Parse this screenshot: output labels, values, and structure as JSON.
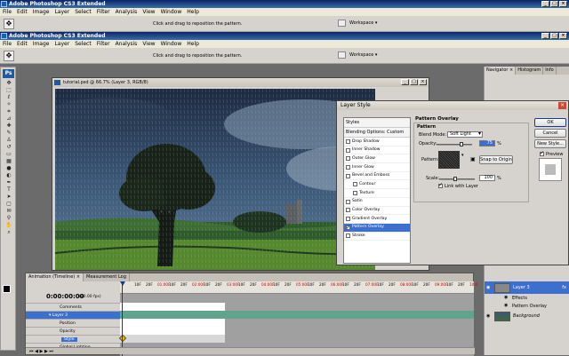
{
  "app": {
    "title": "Adobe Photoshop CS3 Extended",
    "menu": [
      "File",
      "Edit",
      "Image",
      "Layer",
      "Select",
      "Filter",
      "Analysis",
      "View",
      "Window",
      "Help"
    ],
    "options_hint": "Click and drag to reposition the pattern.",
    "workspace_label": "Workspace ▾"
  },
  "document": {
    "title": "tutorial.psd @ 66.7% (Layer 3, RGB/8)"
  },
  "navigator": {
    "tabs": [
      "Navigator ×",
      "Histogram",
      "Info"
    ]
  },
  "layer_style": {
    "title": "Layer Style",
    "list_header": "Styles",
    "blending": "Blending Options: Custom",
    "items": [
      {
        "label": "Drop Shadow",
        "checked": false,
        "sub": false,
        "selected": false
      },
      {
        "label": "Inner Shadow",
        "checked": false,
        "sub": false,
        "selected": false
      },
      {
        "label": "Outer Glow",
        "checked": false,
        "sub": false,
        "selected": false
      },
      {
        "label": "Inner Glow",
        "checked": false,
        "sub": false,
        "selected": false
      },
      {
        "label": "Bevel and Emboss",
        "checked": false,
        "sub": false,
        "selected": false
      },
      {
        "label": "Contour",
        "checked": false,
        "sub": true,
        "selected": false
      },
      {
        "label": "Texture",
        "checked": false,
        "sub": true,
        "selected": false
      },
      {
        "label": "Satin",
        "checked": false,
        "sub": false,
        "selected": false
      },
      {
        "label": "Color Overlay",
        "checked": false,
        "sub": false,
        "selected": false
      },
      {
        "label": "Gradient Overlay",
        "checked": false,
        "sub": false,
        "selected": false
      },
      {
        "label": "Pattern Overlay",
        "checked": true,
        "sub": false,
        "selected": true
      },
      {
        "label": "Stroke",
        "checked": false,
        "sub": false,
        "selected": false
      }
    ],
    "section_title": "Pattern Overlay",
    "group_title": "Pattern",
    "blend_mode_label": "Blend Mode:",
    "blend_mode_value": "Soft Light",
    "opacity_label": "Opacity:",
    "opacity_value": "75",
    "pattern_label": "Pattern:",
    "snap_button": "Snap to Origin",
    "scale_label": "Scale:",
    "scale_value": "100",
    "percent": "%",
    "link_label": "Link with Layer",
    "ok": "OK",
    "cancel": "Cancel",
    "new_style": "New Style...",
    "preview_label": "Preview"
  },
  "layers": {
    "layer3": "Layer 3",
    "effects": "Effects",
    "pattern_overlay": "Pattern Overlay",
    "background": "Background"
  },
  "animation": {
    "tabs": [
      "Animation (Timeline) ×",
      "Measurement Log"
    ],
    "time": "0:00:00:00",
    "fps": "(30.00 fps)",
    "rows": {
      "comments": "Comments",
      "layer": "Layer 3",
      "position": "Position",
      "opacity": "Opacity",
      "style": "Style",
      "global_lighting": "Global Lighting"
    },
    "ticks": [
      "10F",
      "20F",
      "01:00F",
      "10F",
      "20F",
      "02:00F",
      "10F",
      "20F",
      "03:00F",
      "10F",
      "20F",
      "04:00F",
      "10F",
      "20F",
      "05:00F",
      "10F",
      "20F",
      "06:00F",
      "10F",
      "20F",
      "07:00F",
      "10F",
      "20F",
      "08:00F",
      "10F",
      "20F",
      "09:00F",
      "10F",
      "20F",
      "10:0"
    ]
  }
}
